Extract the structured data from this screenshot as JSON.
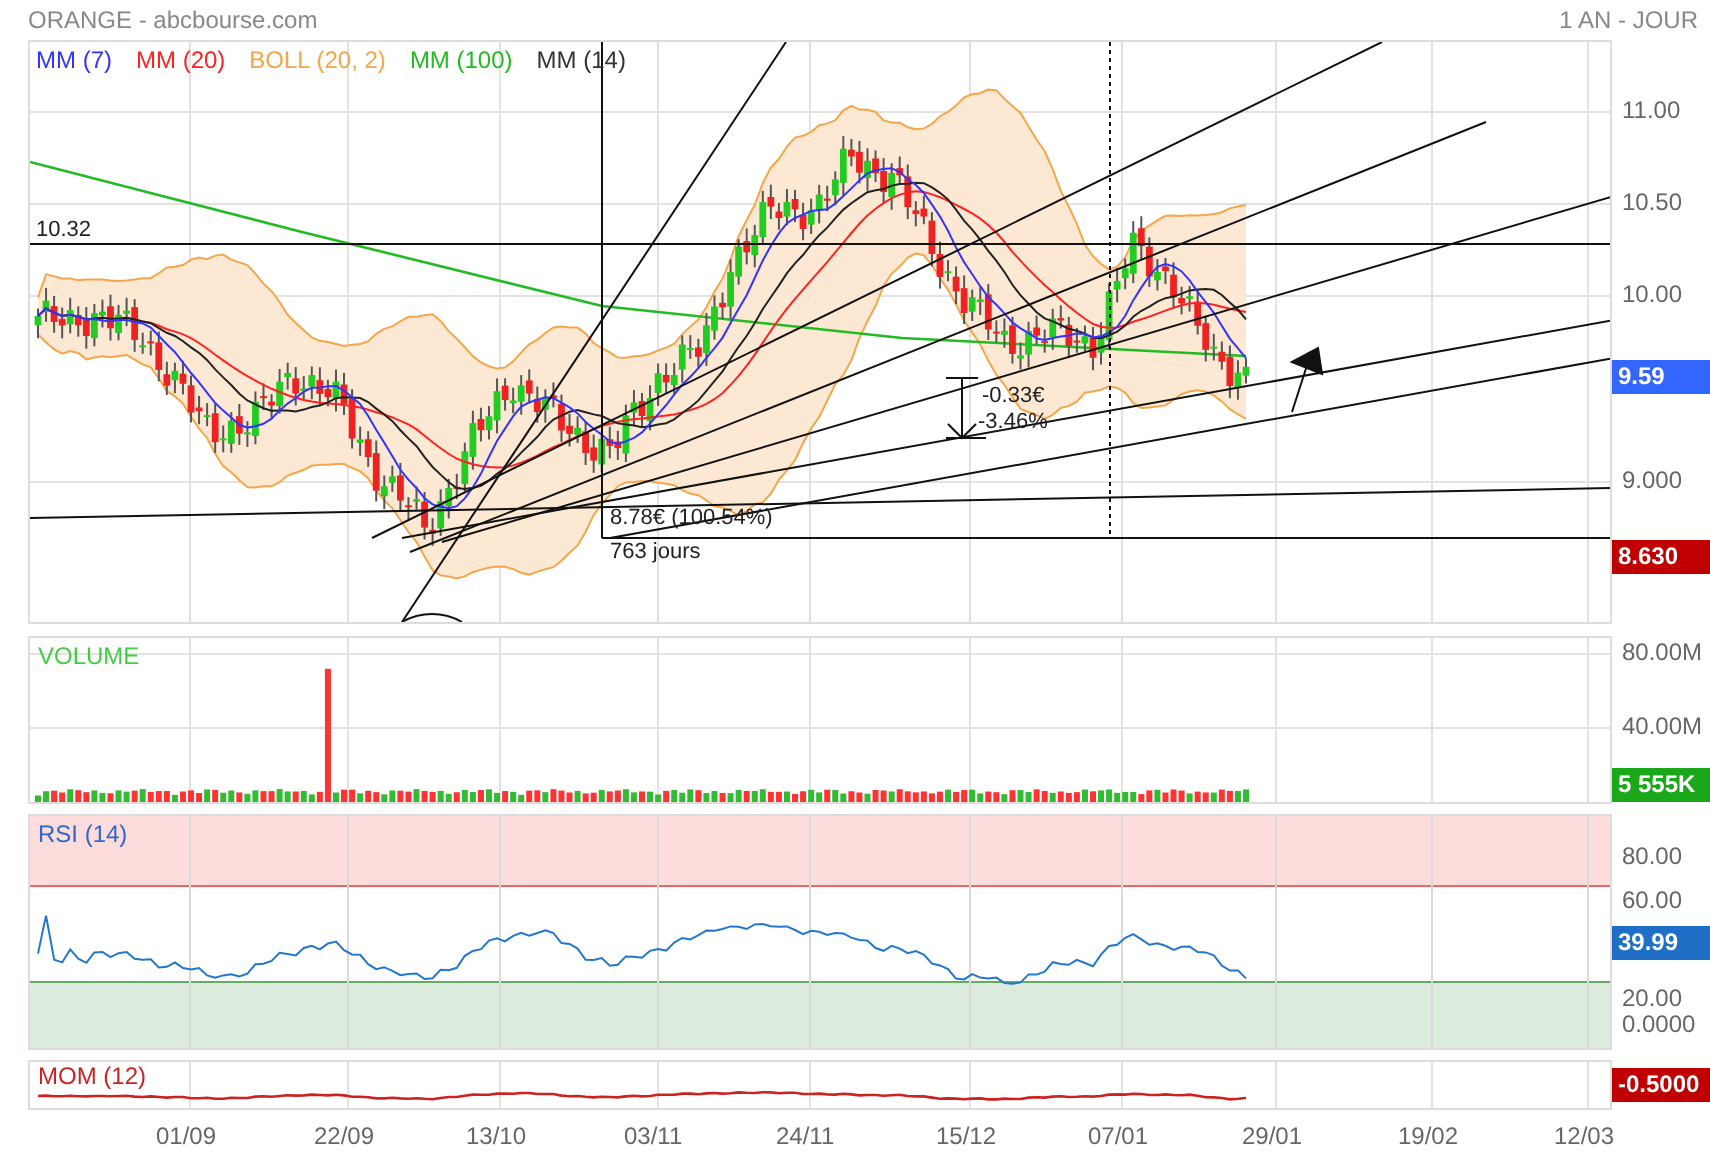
{
  "header": {
    "title": "ORANGE - abcbourse.com",
    "period": "1 AN - JOUR"
  },
  "price_panel": {
    "legend": [
      {
        "label": "MM (7)",
        "color": "#3333ff"
      },
      {
        "label": "MM (20)",
        "color": "#ff2222"
      },
      {
        "label": "BOLL (20, 2)",
        "color": "#f5a54a"
      },
      {
        "label": "MM (100)",
        "color": "#22bb22"
      },
      {
        "label": "MM (14)",
        "color": "#333333"
      }
    ],
    "axis_labels": [
      "11.00",
      "10.50",
      "10.00",
      "9.000"
    ],
    "level_label": "10.32",
    "annotations": [
      "-0.33€",
      "-3.46%",
      "8.78€ (100.54%)",
      "763 jours"
    ],
    "badges": [
      {
        "text": "9.59",
        "color": "#3366ff"
      },
      {
        "text": "8.630",
        "color": "#c00000"
      }
    ]
  },
  "volume_panel": {
    "title": "VOLUME",
    "axis_labels": [
      "80.00M",
      "40.00M"
    ],
    "badge": {
      "text": "5 555K",
      "color": "#1aa81a"
    }
  },
  "rsi_panel": {
    "title": "RSI (14)",
    "axis_labels": [
      "80.00",
      "60.00",
      "20.00",
      "0.0000"
    ],
    "badge": {
      "text": "39.99",
      "color": "#1f6fc6"
    }
  },
  "mom_panel": {
    "title": "MOM (12)",
    "badge": {
      "text": "-0.5000",
      "color": "#c00000"
    }
  },
  "x_axis": [
    "01/09",
    "22/09",
    "13/10",
    "03/11",
    "24/11",
    "15/12",
    "07/01",
    "29/01",
    "19/02",
    "12/03"
  ]
}
